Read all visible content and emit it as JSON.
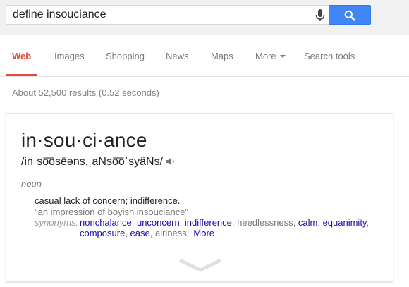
{
  "search": {
    "query": "define insouciance"
  },
  "tabs": [
    {
      "label": "Web",
      "active": true
    },
    {
      "label": "Images"
    },
    {
      "label": "Shopping"
    },
    {
      "label": "News"
    },
    {
      "label": "Maps"
    },
    {
      "label": "More"
    },
    {
      "label": "Search tools"
    }
  ],
  "results": {
    "stats": "About 52,500 results (0.52 seconds)"
  },
  "definition": {
    "headword": "in·sou·ci·ance",
    "pronunciation": "/inˈso͞osēəns,ˌaNso͞oˈsyäNs/",
    "part_of_speech": "noun",
    "definition": "casual lack of concern; indifference.",
    "example": "\"an impression of boyish insouciance\"",
    "synonyms_label": "synonyms:",
    "synonyms": [
      {
        "word": "nonchalance",
        "linked": true
      },
      {
        "word": "unconcern",
        "linked": true
      },
      {
        "word": "indifference",
        "linked": true
      },
      {
        "word": "heedlessness",
        "linked": false
      },
      {
        "word": "calm",
        "linked": true
      },
      {
        "word": "equanimity",
        "linked": true
      },
      {
        "word": "composure",
        "linked": true
      },
      {
        "word": "ease",
        "linked": true
      },
      {
        "word": "airiness",
        "linked": false
      }
    ],
    "more_label": "More"
  },
  "colors": {
    "accent_red": "#dd4b39",
    "search_blue": "#4285f4",
    "link_blue": "#1a0dab"
  },
  "icons": {
    "mic": "microphone-icon",
    "search": "magnifier-icon",
    "speaker": "speaker-icon",
    "expand": "chevron-down-icon"
  }
}
